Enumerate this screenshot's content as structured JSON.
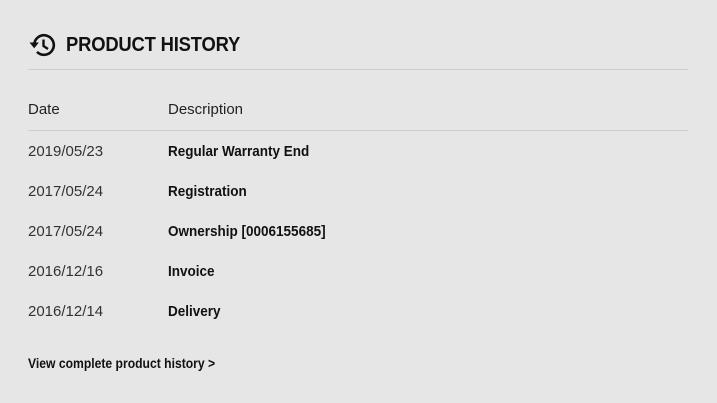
{
  "header": {
    "icon": "history-icon",
    "title": "PRODUCT HISTORY"
  },
  "table": {
    "columns": [
      "Date",
      "Description"
    ],
    "rows": [
      {
        "date": "2019/05/23",
        "description": "Regular Warranty End"
      },
      {
        "date": "2017/05/24",
        "description": "Registration"
      },
      {
        "date": "2017/05/24",
        "description": "Ownership [0006155685]"
      },
      {
        "date": "2016/12/16",
        "description": "Invoice"
      },
      {
        "date": "2016/12/14",
        "description": "Delivery"
      }
    ]
  },
  "footer": {
    "link_label": "View complete product history >"
  },
  "colors": {
    "background": "#e6e6e6",
    "text": "#111111",
    "divider": "#cfcfcf"
  }
}
